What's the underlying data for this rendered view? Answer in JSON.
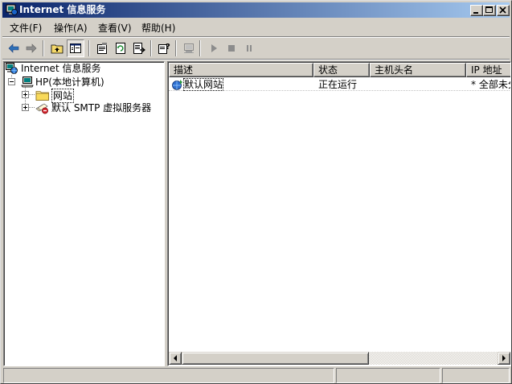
{
  "window": {
    "title": "Internet 信息服务"
  },
  "menu": [
    {
      "label": "文件(F)"
    },
    {
      "label": "操作(A)"
    },
    {
      "label": "查看(V)"
    },
    {
      "label": "帮助(H)"
    }
  ],
  "toolbar": {
    "buttons": [
      "back-arrow-icon",
      "forward-arrow-icon",
      "up-folder-icon",
      "show-tree-icon",
      "properties-icon",
      "refresh-icon",
      "export-list-icon",
      "help-icon",
      "connect-computer-icon",
      "play-icon",
      "stop-icon",
      "pause-icon"
    ]
  },
  "tree": {
    "root": "Internet 信息服务",
    "computer": "HP(本地计算机)",
    "websites": "网站",
    "smtp": "默认 SMTP 虚拟服务器"
  },
  "list": {
    "columns": [
      "描述",
      "状态",
      "主机头名",
      "IP 地址"
    ],
    "rows": [
      {
        "description": "默认网站",
        "status": "正在运行",
        "host": "",
        "ip": "* 全部未分"
      }
    ]
  },
  "colors": {
    "title_start": "#0a246a",
    "title_end": "#a6caf0",
    "face": "#d4d0c8"
  }
}
